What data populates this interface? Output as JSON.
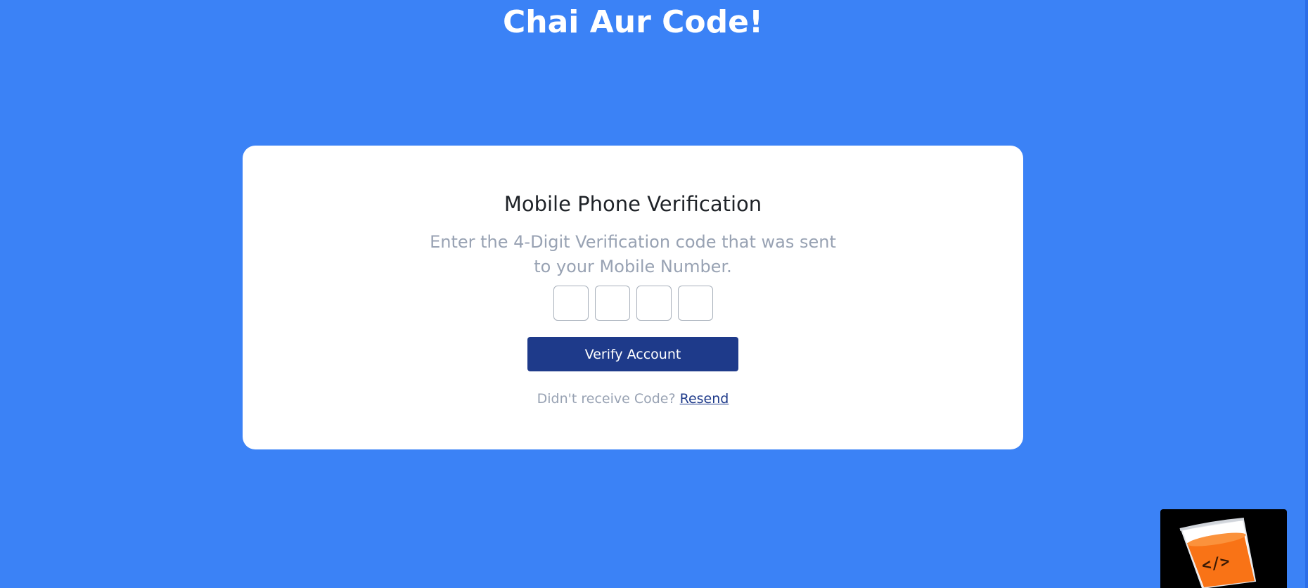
{
  "header": {
    "title": "Chai Aur Code!"
  },
  "card": {
    "title": "Mobile Phone Verification",
    "description": "Enter the 4-Digit Verification code that was sent to your Mobile Number.",
    "otp": {
      "digits": [
        "",
        "",
        "",
        ""
      ]
    },
    "verify_button_label": "Verify Account",
    "resend_prompt": "Didn't receive Code?",
    "resend_link_label": "Resend"
  },
  "logo": {
    "icon": "chai-cup-code-icon",
    "glyph": "</>"
  },
  "colors": {
    "background": "#3b82f6",
    "card": "#ffffff",
    "button": "#1e3a8a",
    "muted_text": "#98a2b3",
    "logo_cup": "#f97316"
  }
}
